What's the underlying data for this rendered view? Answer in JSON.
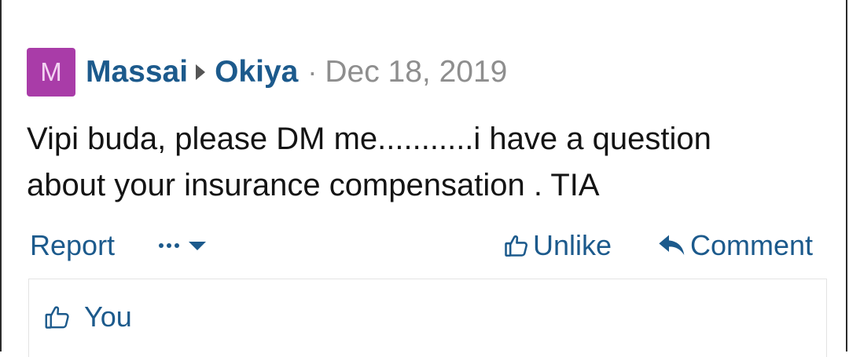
{
  "post": {
    "avatar_letter": "M",
    "author": "Massai",
    "recipient": "Okiya",
    "separator": "·",
    "date": "Dec 18, 2019",
    "message_lines": [
      "Vipi buda, please DM me...........i have a question",
      "about your insurance compensation . TIA"
    ]
  },
  "actions": {
    "report": "Report",
    "unlike": "Unlike",
    "comment": "Comment"
  },
  "likes": {
    "label": "You"
  },
  "icons": {
    "like": "thumbs-up-icon",
    "reply": "reply-arrow-icon",
    "more": "more-dots-icon",
    "caret": "caret-down-icon"
  },
  "colors": {
    "link": "#1c5a8c",
    "avatar_bg": "#a93ca8",
    "muted": "#8e8e8e",
    "text": "#141414"
  }
}
